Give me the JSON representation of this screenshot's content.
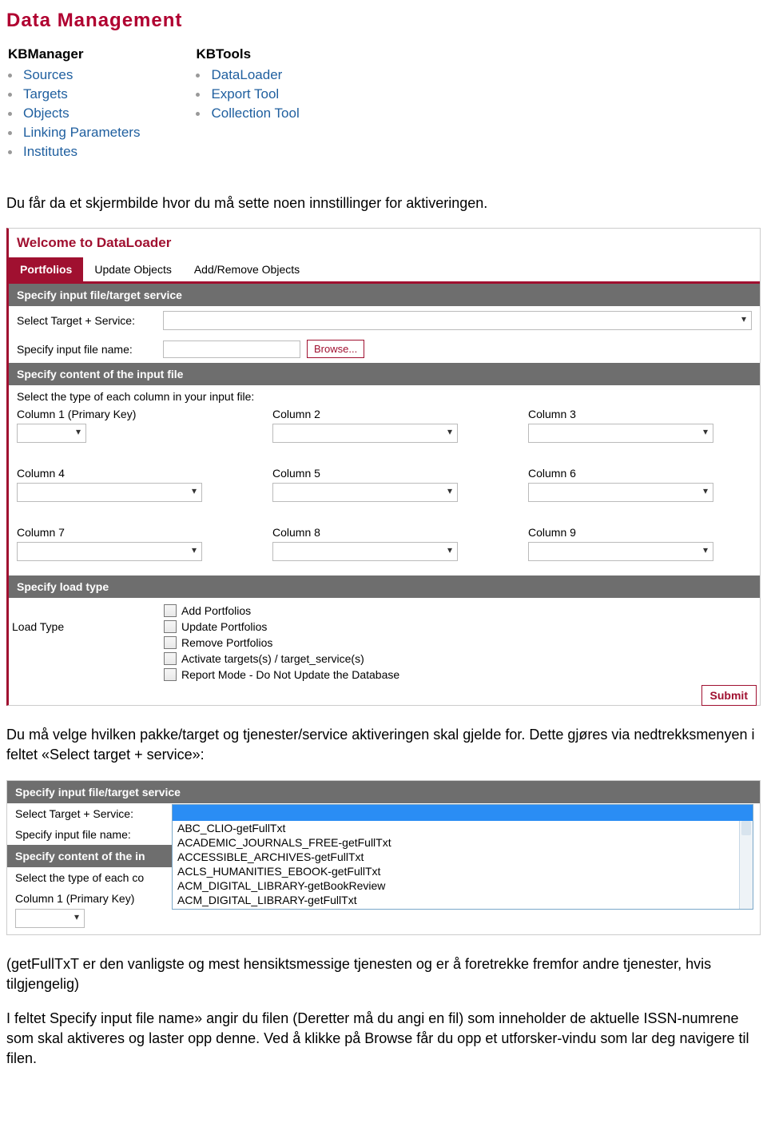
{
  "dm_heading": "Data Management",
  "nav": {
    "col1_title": "KBManager",
    "col1_items": [
      "Sources",
      "Targets",
      "Objects",
      "Linking Parameters",
      "Institutes"
    ],
    "col2_title": "KBTools",
    "col2_items": [
      "DataLoader",
      "Export Tool",
      "Collection Tool"
    ]
  },
  "para1": "Du får da et skjermbilde hvor du må sette noen innstillinger for aktiveringen.",
  "dl": {
    "welcome": "Welcome to DataLoader",
    "tabs": [
      "Portfolios",
      "Update Objects",
      "Add/Remove Objects"
    ],
    "sec_input": "Specify input file/target service",
    "label_target": "Select Target + Service:",
    "label_file": "Specify input file name:",
    "browse": "Browse...",
    "sec_content": "Specify content of the input file",
    "cols_instr": "Select the type of each column in your input file:",
    "col_labels": [
      "Column 1 (Primary Key)",
      "Column 2",
      "Column 3",
      "Column 4",
      "Column 5",
      "Column 6",
      "Column 7",
      "Column 8",
      "Column 9"
    ],
    "sec_loadtype": "Specify load type",
    "loadtype_label": "Load Type",
    "loadtype_opts": [
      "Add Portfolios",
      "Update Portfolios",
      "Remove Portfolios",
      "Activate targets(s) / target_service(s)",
      "Report Mode - Do Not Update the Database"
    ],
    "submit": "Submit"
  },
  "para2": "Du må velge hvilken pakke/target og tjenester/service aktiveringen skal gjelde for. Dette gjøres via nedtrekksmenyen i feltet «Select target + service»:",
  "p2": {
    "sec_input": "Specify input file/target service",
    "label_target": "Select Target + Service:",
    "label_file": "Specify input file name:",
    "sec_content": "Specify content of the in",
    "cols_instr": "Select the type of each co",
    "col1_label": "Column 1 (Primary Key)",
    "dropdown_items": [
      "ABC_CLIO-getFullTxt",
      "ACADEMIC_JOURNALS_FREE-getFullTxt",
      "ACCESSIBLE_ARCHIVES-getFullTxt",
      "ACLS_HUMANITIES_EBOOK-getFullTxt",
      "ACM_DIGITAL_LIBRARY-getBookReview",
      "ACM_DIGITAL_LIBRARY-getFullTxt"
    ]
  },
  "para3": "(getFullTxT er den vanligste og mest hensiktsmessige tjenesten og er å foretrekke fremfor andre tjenester, hvis tilgjengelig)",
  "para4": "I feltet Specify input file name» angir du filen (Deretter må du angi en fil) som inneholder de aktuelle ISSN-numrene som skal aktiveres og laster opp denne. Ved å klikke på Browse får du opp et utforsker-vindu som lar deg navigere til filen."
}
